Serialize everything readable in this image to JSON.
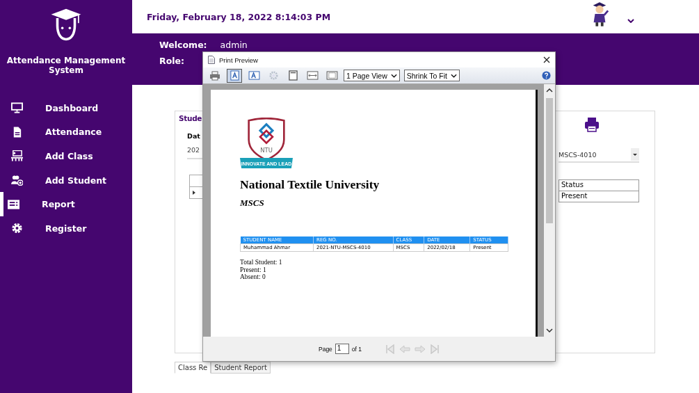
{
  "sidebar": {
    "title": "Attendance Management System",
    "items": [
      {
        "label": "Dashboard",
        "selected": false
      },
      {
        "label": "Attendance",
        "selected": false
      },
      {
        "label": "Add Class",
        "selected": false
      },
      {
        "label": "Add Student",
        "selected": false
      },
      {
        "label": "Report",
        "selected": true
      },
      {
        "label": "Register",
        "selected": false
      }
    ]
  },
  "header": {
    "datetime": "Friday, February 18, 2022 8:14:03 PM"
  },
  "user": {
    "welcome_label": "Welcome:",
    "name": "admin",
    "role_label": "Role:"
  },
  "panel": {
    "title": "Stude",
    "date_label": "Dat",
    "date_value": "202",
    "student_value": "MSCS-4010",
    "grid_column": "Status",
    "grid_value": "Present"
  },
  "tabs": [
    {
      "label": "Class Re",
      "selected": true
    },
    {
      "label": "Student Report",
      "selected": false
    }
  ],
  "print_preview": {
    "title": "Print Preview",
    "toolbar": [
      {
        "kind": "print",
        "selected": false
      },
      {
        "kind": "portrait",
        "selected": true
      },
      {
        "kind": "landscape",
        "selected": false
      },
      {
        "kind": "settings",
        "selected": false
      },
      {
        "kind": "one-page",
        "selected": false
      },
      {
        "kind": "page-width",
        "selected": false
      },
      {
        "kind": "whole-page",
        "selected": false
      }
    ],
    "view_select": "1 Page View",
    "zoom_select": "Shrink To Fit",
    "report": {
      "logo_text": "NTU",
      "logo_motto": "INNOVATE AND LEAD",
      "institution": "National Textile University",
      "program": "MSCS",
      "columns": [
        "STUDENT NAME",
        "REG NO.",
        "CLASS",
        "DATE",
        "STATUS"
      ],
      "rows": [
        [
          "Muhammad Ahmar",
          "2021-NTU-MSCS-4010",
          "MSCS",
          "2022/02/18",
          "Present"
        ]
      ],
      "summary": [
        "Total Student: 1",
        "Present: 1",
        "Absent: 0"
      ]
    },
    "page_label": "Page",
    "page_value": "1",
    "page_of": "of 1"
  }
}
